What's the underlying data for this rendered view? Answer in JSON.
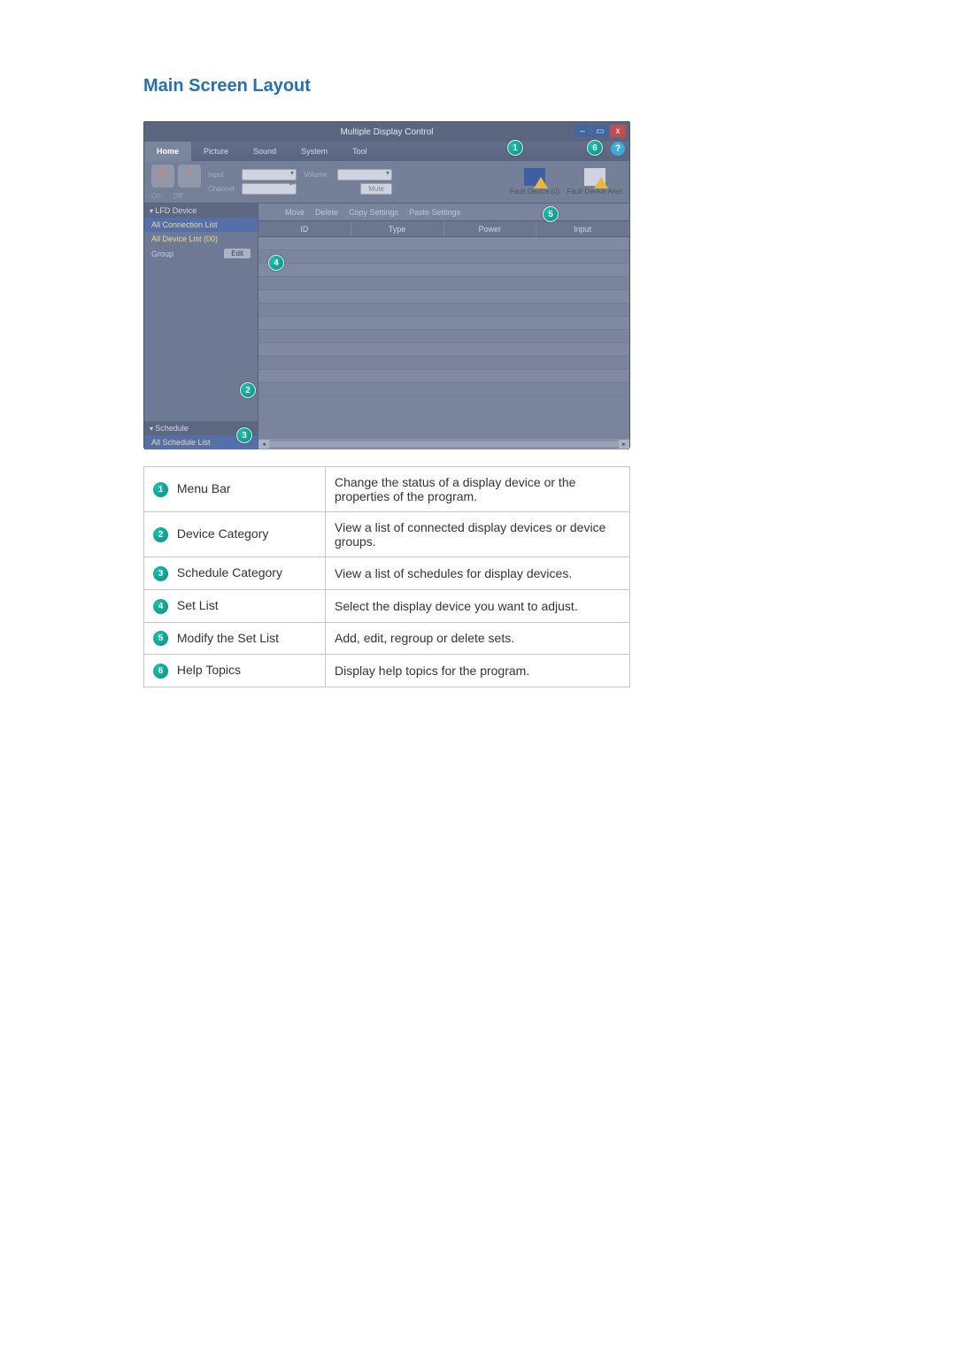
{
  "heading": "Main Screen Layout",
  "window": {
    "title": "Multiple Display Control",
    "tabs": [
      "Home",
      "Picture",
      "Sound",
      "System",
      "Tool"
    ],
    "onoff": {
      "on": "On",
      "off": "Off"
    },
    "labels": {
      "input": "Input",
      "channel": "Channel",
      "volume": "Volume",
      "mute": "Mute"
    },
    "fault1": "Fault Device (0)",
    "fault2": "Fault Device Alert",
    "side": {
      "lfd": "LFD Device",
      "allconn": "All Connection List",
      "alldev": "All Device List (00)",
      "group": "Group",
      "edit": "Edit",
      "schedule": "Schedule",
      "allsched": "All Schedule List"
    },
    "toolbar": {
      "move": "Move",
      "delete": "Delete",
      "copy": "Copy Settings",
      "paste": "Paste Settings"
    },
    "cols": {
      "id": "ID",
      "type": "Type",
      "power": "Power",
      "input": "Input"
    }
  },
  "legend": [
    {
      "n": "1",
      "label": "Menu Bar",
      "desc": "Change the status of a display device or the properties of the program."
    },
    {
      "n": "2",
      "label": "Device Category",
      "desc": "View a list of connected display devices or device groups."
    },
    {
      "n": "3",
      "label": "Schedule Category",
      "desc": "View a list of schedules for display devices."
    },
    {
      "n": "4",
      "label": "Set List",
      "desc": "Select the display device you want to adjust."
    },
    {
      "n": "5",
      "label": "Modify the Set List",
      "desc": "Add, edit, regroup or delete sets."
    },
    {
      "n": "6",
      "label": "Help Topics",
      "desc": "Display help topics for the program."
    }
  ]
}
